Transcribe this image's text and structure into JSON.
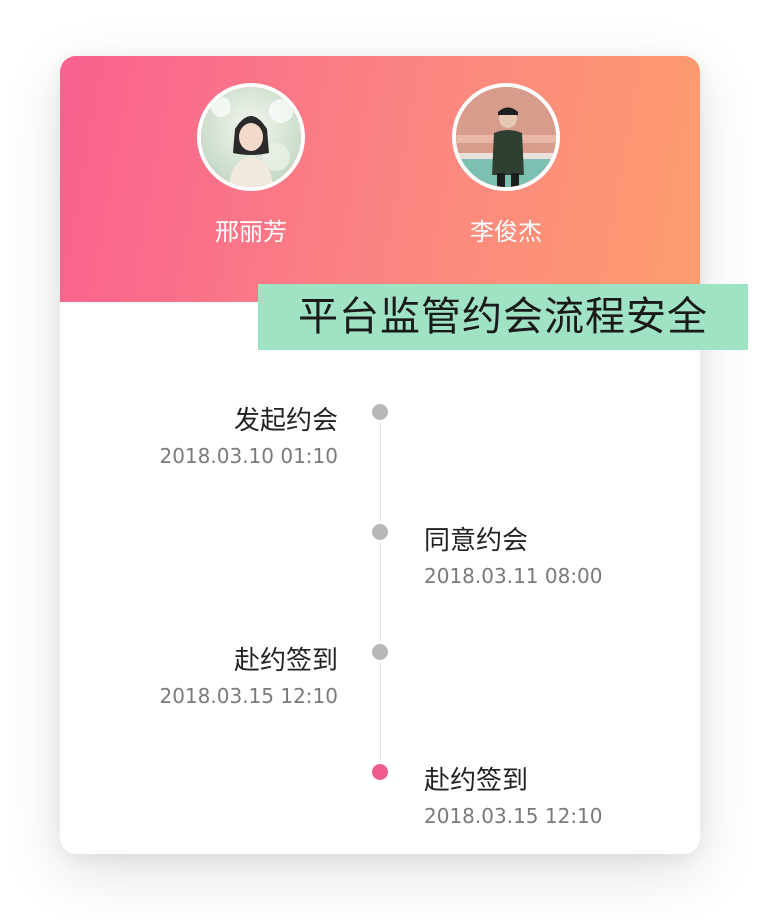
{
  "header": {
    "left_user": {
      "name": "邢丽芳"
    },
    "right_user": {
      "name": "李俊杰"
    },
    "gradient": {
      "from": "#f9608f",
      "to": "#fd9d6d"
    }
  },
  "banner": {
    "text": "平台监管约会流程安全",
    "background": "#9fe2c4"
  },
  "timeline": {
    "events": [
      {
        "title": "发起约会",
        "time": "2018.03.10 01:10",
        "side": "left",
        "status": "done"
      },
      {
        "title": "同意约会",
        "time": "2018.03.11 08:00",
        "side": "right",
        "status": "done"
      },
      {
        "title": "赴约签到",
        "time": "2018.03.15 12:10",
        "side": "left",
        "status": "done"
      },
      {
        "title": "赴约签到",
        "time": "2018.03.15 12:10",
        "side": "right",
        "status": "current"
      }
    ],
    "colors": {
      "done": "#b9b9b9",
      "current": "#f05b8e"
    }
  }
}
